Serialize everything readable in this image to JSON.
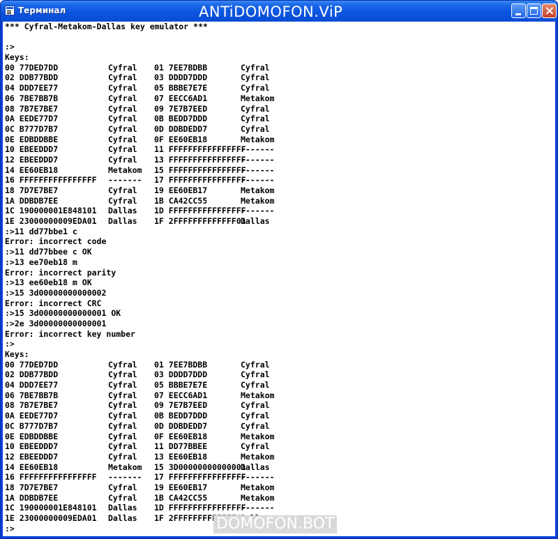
{
  "window": {
    "title": "Терминал",
    "watermark_top": "ANTiDOMOFON.ViP",
    "watermark_bottom": "DOMOFON.BOT"
  },
  "terminal": {
    "banner": "*** Cyfral-Metakom-Dallas key emulator ***",
    "lines": [
      {
        "type": "text",
        "text": ""
      },
      {
        "type": "text",
        "text": ":>"
      },
      {
        "type": "text",
        "text": "Keys:"
      },
      {
        "type": "row",
        "c": [
          "00 77DED7DD",
          "Cyfral",
          "01 7EE7BDBB",
          "Cyfral"
        ]
      },
      {
        "type": "row",
        "c": [
          "02 DDB77BDD",
          "Cyfral",
          "03 DDDD7DDD",
          "Cyfral"
        ]
      },
      {
        "type": "row",
        "c": [
          "04 DDD7EE77",
          "Cyfral",
          "05 BBBE7E7E",
          "Cyfral"
        ]
      },
      {
        "type": "row",
        "c": [
          "06 7BE7BB7B",
          "Cyfral",
          "07 EECC6AD1",
          "Metakom"
        ]
      },
      {
        "type": "row",
        "c": [
          "08 7B7E7BE7",
          "Cyfral",
          "09 7E7B7EED",
          "Cyfral"
        ]
      },
      {
        "type": "row",
        "c": [
          "0A EEDE77D7",
          "Cyfral",
          "0B BEDD7DDD",
          "Cyfral"
        ]
      },
      {
        "type": "row",
        "c": [
          "0C B777D7B7",
          "Cyfral",
          "0D DDBDEDD7",
          "Cyfral"
        ]
      },
      {
        "type": "row",
        "c": [
          "0E EDBDDBBE",
          "Cyfral",
          "0F EE60EB18",
          "Metakom"
        ]
      },
      {
        "type": "row",
        "c": [
          "10 EBEEDDD7",
          "Cyfral",
          "11 FFFFFFFFFFFFFFFF",
          "-------"
        ]
      },
      {
        "type": "row",
        "c": [
          "12 EBEEDDD7",
          "Cyfral",
          "13 FFFFFFFFFFFFFFFF",
          "-------"
        ]
      },
      {
        "type": "row",
        "c": [
          "14 EE60EB18",
          "Metakom",
          "15 FFFFFFFFFFFFFFFF",
          "-------"
        ]
      },
      {
        "type": "row",
        "c": [
          "16 FFFFFFFFFFFFFFFF",
          "-------",
          "17 FFFFFFFFFFFFFFFF",
          "-------"
        ]
      },
      {
        "type": "row",
        "c": [
          "18 7D7E7BE7",
          "Cyfral",
          "19 EE60EB17",
          "Metakom"
        ]
      },
      {
        "type": "row",
        "c": [
          "1A DDBDB7EE",
          "Cyfral",
          "1B CA42CC55",
          "Metakom"
        ]
      },
      {
        "type": "row",
        "c": [
          "1C 190000001E848101",
          "Dallas",
          "1D FFFFFFFFFFFFFFFF",
          "-------"
        ]
      },
      {
        "type": "row",
        "c": [
          "1E 23000000009EDA01",
          "Dallas",
          "1F 2FFFFFFFFFFFFF01",
          "Dallas"
        ]
      },
      {
        "type": "text",
        "text": ":>11 dd77bbe1 c"
      },
      {
        "type": "text",
        "text": "Error: incorrect code"
      },
      {
        "type": "text",
        "text": ":>11 dd77bbee c OK"
      },
      {
        "type": "text",
        "text": ":>13 ee70eb18 m"
      },
      {
        "type": "text",
        "text": "Error: incorrect parity"
      },
      {
        "type": "text",
        "text": ":>13 ee60eb18 m OK"
      },
      {
        "type": "text",
        "text": ":>15 3d00000000000002"
      },
      {
        "type": "text",
        "text": "Error: incorrect CRC"
      },
      {
        "type": "text",
        "text": ":>15 3d00000000000001 OK"
      },
      {
        "type": "text",
        "text": ":>2e 3d00000000000001"
      },
      {
        "type": "text",
        "text": "Error: incorrect key number"
      },
      {
        "type": "text",
        "text": ":>"
      },
      {
        "type": "text",
        "text": "Keys:"
      },
      {
        "type": "row",
        "c": [
          "00 77DED7DD",
          "Cyfral",
          "01 7EE7BDBB",
          "Cyfral"
        ]
      },
      {
        "type": "row",
        "c": [
          "02 DDB77BDD",
          "Cyfral",
          "03 DDDD7DDD",
          "Cyfral"
        ]
      },
      {
        "type": "row",
        "c": [
          "04 DDD7EE77",
          "Cyfral",
          "05 BBBE7E7E",
          "Cyfral"
        ]
      },
      {
        "type": "row",
        "c": [
          "06 7BE7BB7B",
          "Cyfral",
          "07 EECC6AD1",
          "Metakom"
        ]
      },
      {
        "type": "row",
        "c": [
          "08 7B7E7BE7",
          "Cyfral",
          "09 7E7B7EED",
          "Cyfral"
        ]
      },
      {
        "type": "row",
        "c": [
          "0A EEDE77D7",
          "Cyfral",
          "0B BEDD7DDD",
          "Cyfral"
        ]
      },
      {
        "type": "row",
        "c": [
          "0C B777D7B7",
          "Cyfral",
          "0D DDBDEDD7",
          "Cyfral"
        ]
      },
      {
        "type": "row",
        "c": [
          "0E EDBDDBBE",
          "Cyfral",
          "0F EE60EB18",
          "Metakom"
        ]
      },
      {
        "type": "row",
        "c": [
          "10 EBEEDDD7",
          "Cyfral",
          "11 DD77BBEE",
          "Cyfral"
        ]
      },
      {
        "type": "row",
        "c": [
          "12 EBEEDDD7",
          "Cyfral",
          "13 EE60EB18",
          "Metakom"
        ]
      },
      {
        "type": "row",
        "c": [
          "14 EE60EB18",
          "Metakom",
          "15 3D00000000000001",
          "Dallas"
        ]
      },
      {
        "type": "row",
        "c": [
          "16 FFFFFFFFFFFFFFFF",
          "-------",
          "17 FFFFFFFFFFFFFFFF",
          "-------"
        ]
      },
      {
        "type": "row",
        "c": [
          "18 7D7E7BE7",
          "Cyfral",
          "19 EE60EB17",
          "Metakom"
        ]
      },
      {
        "type": "row",
        "c": [
          "1A DDBDB7EE",
          "Cyfral",
          "1B CA42CC55",
          "Metakom"
        ]
      },
      {
        "type": "row",
        "c": [
          "1C 190000001E848101",
          "Dallas",
          "1D FFFFFFFFFFFFFFFF",
          "-------"
        ]
      },
      {
        "type": "row",
        "c": [
          "1E 23000000009EDA01",
          "Dallas",
          "1F 2FFFFFFFFFFFFF01",
          "Dallas"
        ]
      },
      {
        "type": "text",
        "text": ":>"
      }
    ]
  },
  "icons": {
    "app": "terminal-app-icon",
    "minimize": "minimize-icon",
    "maximize": "maximize-icon",
    "close": "close-icon"
  },
  "colors": {
    "titlebar": "#0b55e0",
    "close_button": "#c8412a",
    "console_bg": "#ffffff",
    "console_text": "#000000"
  }
}
